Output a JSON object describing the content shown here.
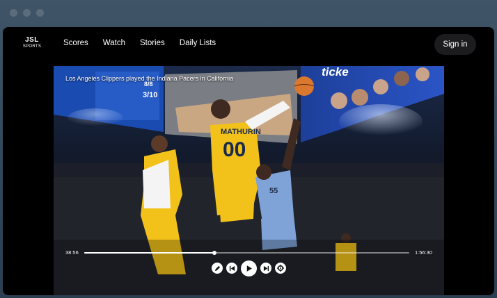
{
  "brand": {
    "line1": "JSL",
    "line2": "SPORTS"
  },
  "nav": {
    "items": [
      "Scores",
      "Watch",
      "Stories",
      "Daily Lists"
    ],
    "signin_label": "Sign in"
  },
  "video": {
    "caption": "Los Angeles Clippers played the Indiana Pacers in California",
    "jumbotron_text": "ticke",
    "scoreboard": {
      "line1": "8/8",
      "line2": "3/10"
    },
    "jersey_yellow": {
      "name": "MATHURIN",
      "number": "00"
    },
    "jersey_blue": {
      "number": "55"
    },
    "time_elapsed": "38:56",
    "time_total": "1:56:30",
    "progress": 0.4
  },
  "icons": {
    "edit": "pencil-icon",
    "prev": "skip-back-icon",
    "play": "play-icon",
    "next": "skip-forward-icon",
    "settings": "gear-icon"
  },
  "colors": {
    "accent_yellow": "#f2c21b",
    "clipper_blue": "#7fa3d6",
    "frame": "#000000"
  }
}
